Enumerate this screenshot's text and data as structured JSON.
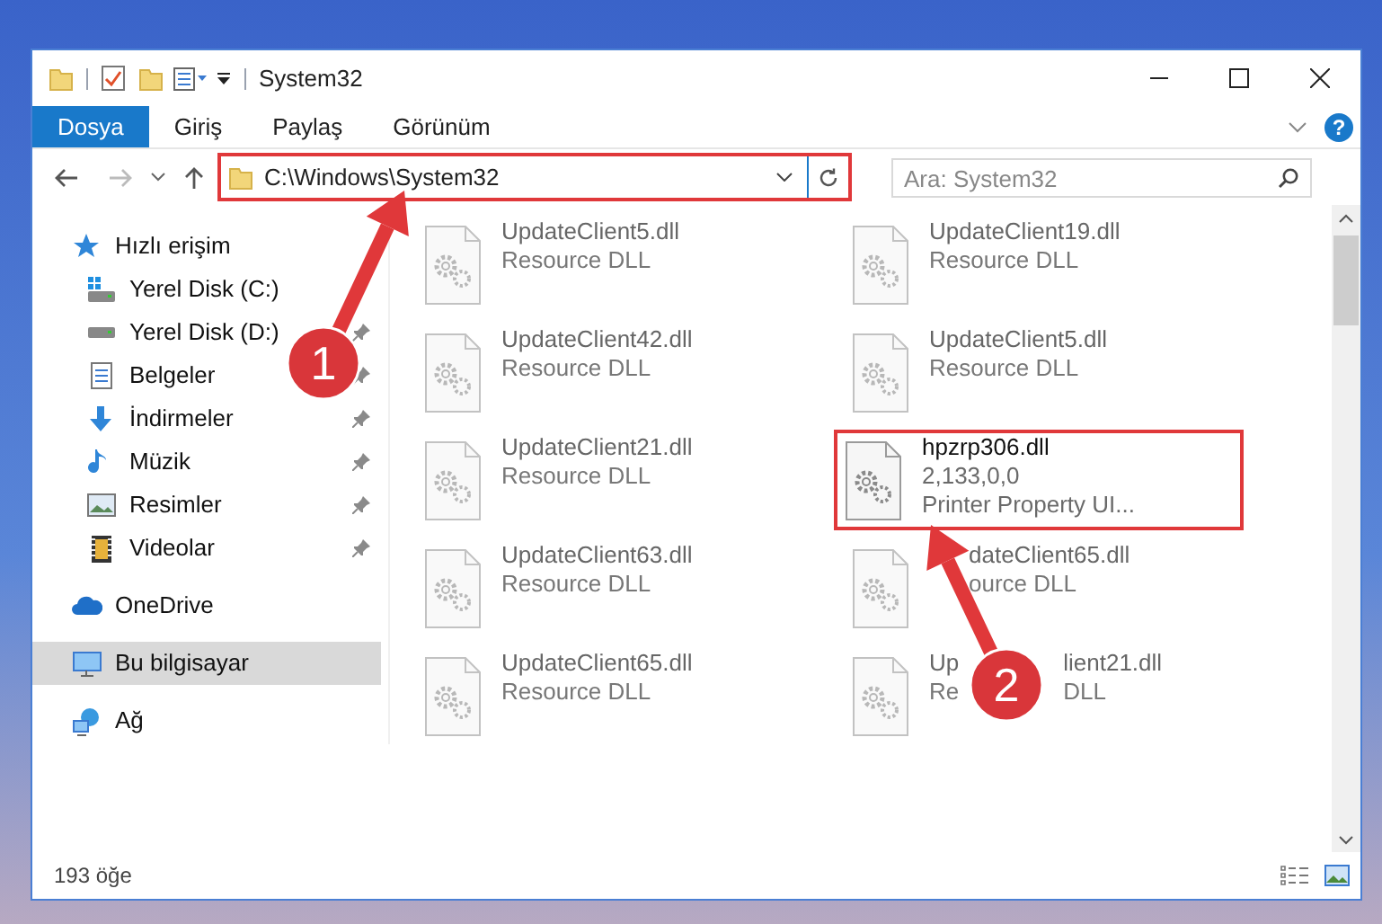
{
  "window": {
    "title": "System32"
  },
  "ribbon_tabs": [
    {
      "label": "Dosya",
      "selected": true
    },
    {
      "label": "Giriş",
      "selected": false
    },
    {
      "label": "Paylaş",
      "selected": false
    },
    {
      "label": "Görünüm",
      "selected": false
    }
  ],
  "address_bar": {
    "path": "C:\\Windows\\System32",
    "highlighted": true
  },
  "search": {
    "placeholder": "Ara: System32"
  },
  "help": "?",
  "sidebar": {
    "items": [
      {
        "label": "Hızlı erişim",
        "selected": false,
        "children": [
          {
            "label": "Yerel Disk (C:)",
            "pinned": false,
            "selected": false
          },
          {
            "label": "Yerel Disk (D:)",
            "pinned": true,
            "selected": false
          },
          {
            "label": "Belgeler",
            "pinned": true,
            "selected": false
          },
          {
            "label": "İndirmeler",
            "pinned": true,
            "selected": false
          },
          {
            "label": "Müzik",
            "pinned": true,
            "selected": false
          },
          {
            "label": "Resimler",
            "pinned": true,
            "selected": false
          },
          {
            "label": "Videolar",
            "pinned": true,
            "selected": false
          }
        ]
      },
      {
        "label": "OneDrive",
        "selected": false
      },
      {
        "label": "Bu bilgisayar",
        "selected": true
      },
      {
        "label": "Ağ",
        "selected": false
      }
    ]
  },
  "files": [
    {
      "name": "UpdateClient5.dll",
      "lines": [
        "Resource DLL"
      ],
      "blurred": true,
      "highlighted": false
    },
    {
      "name": "UpdateClient19.dll",
      "lines": [
        "Resource DLL"
      ],
      "blurred": true,
      "highlighted": false
    },
    {
      "name": "UpdateClient42.dll",
      "lines": [
        "Resource DLL"
      ],
      "blurred": true,
      "highlighted": false
    },
    {
      "name": "UpdateClient5.dll",
      "lines": [
        "Resource DLL"
      ],
      "blurred": true,
      "highlighted": false
    },
    {
      "name": "UpdateClient21.dll",
      "lines": [
        "Resource DLL"
      ],
      "blurred": true,
      "highlighted": false
    },
    {
      "name": "hpzrp306.dll",
      "lines": [
        "2,133,0,0",
        "Printer Property UI..."
      ],
      "blurred": false,
      "highlighted": true
    },
    {
      "name": "UpdateClient63.dll",
      "lines": [
        "Resource DLL"
      ],
      "blurred": true,
      "highlighted": false
    },
    {
      "name": "dateClient65.dll",
      "lines": [
        "ource DLL"
      ],
      "blurred": true,
      "highlighted": false,
      "kind": "covered-left"
    },
    {
      "name": "UpdateClient65.dll",
      "lines": [
        "Resource DLL"
      ],
      "blurred": true,
      "highlighted": false
    },
    {
      "name_parts": [
        "Up",
        "lient21.dll"
      ],
      "line_parts": [
        [
          "Re",
          "DLL"
        ]
      ],
      "blurred": true,
      "highlighted": false,
      "kind": "covered-middle"
    }
  ],
  "status_bar": {
    "item_count": "193 öğe"
  },
  "annotations": [
    {
      "label": "1"
    },
    {
      "label": "2"
    }
  ]
}
